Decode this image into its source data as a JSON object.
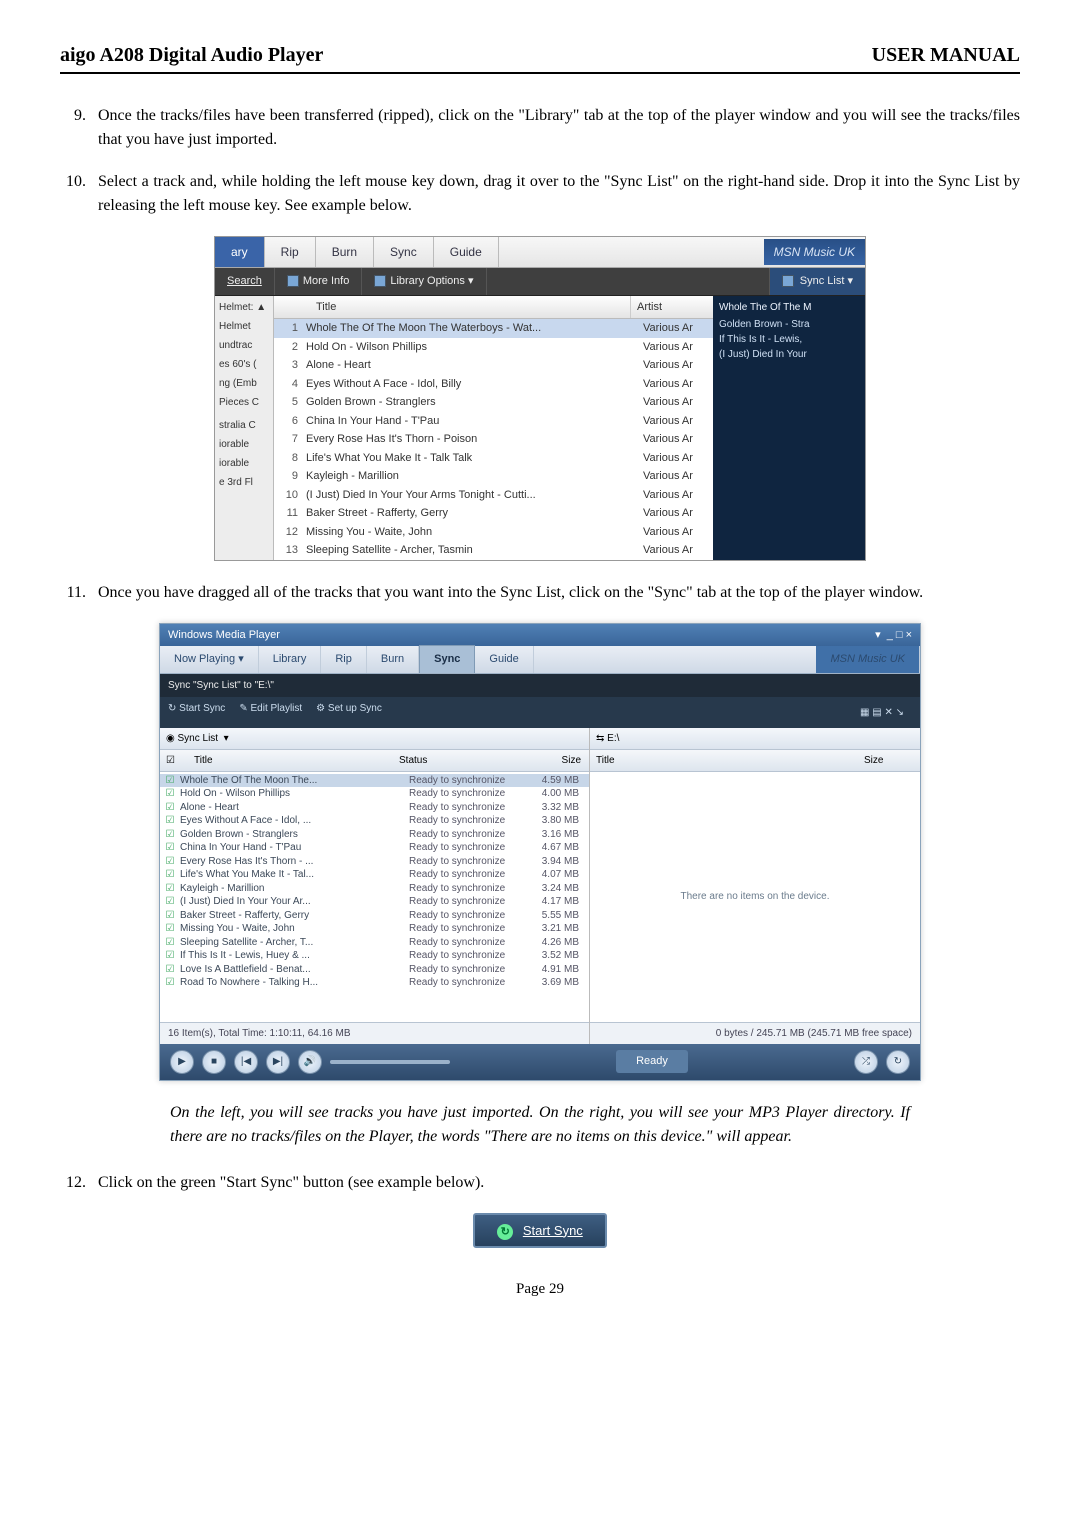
{
  "header": {
    "product": "aigo A208 Digital Audio Player",
    "doc": "USER MANUAL"
  },
  "steps": {
    "s9": "Once the tracks/files have been transferred (ripped), click on the \"Library\" tab at the top of the player window and you will see the tracks/files that you have just imported.",
    "s10": "Select a track and, while holding the left mouse key down, drag it over to the \"Sync List\" on the right-hand side.  Drop it into the Sync List by releasing the left mouse key.  See example below.",
    "s11": "Once you have dragged all of the tracks that you want into the Sync List, click on the \"Sync\" tab at the top of the player window.",
    "s12": "Click on the green \"Start Sync\" button (see example below)."
  },
  "ss1": {
    "tabs": {
      "ary": "ary",
      "rip": "Rip",
      "burn": "Burn",
      "sync": "Sync",
      "guide": "Guide"
    },
    "msn": "MSN Music UK",
    "toolbar": {
      "search": "Search",
      "more_info": "More Info",
      "lib_options": "Library Options ▾",
      "sync_list": "Sync List ▾"
    },
    "thead": {
      "title": "Title",
      "artist": "Artist"
    },
    "left_items": [
      "Helmet: ▲",
      "Helmet",
      "undtrac",
      "es 60's (",
      "ng (Emb",
      "Pieces C",
      "",
      "stralia C",
      "iorable",
      "iorable",
      "e 3rd Fl"
    ],
    "rows": [
      {
        "n": "1",
        "t": "Whole The Of The Moon The Waterboys - Wat...",
        "a": "Various Ar",
        "sel": true
      },
      {
        "n": "2",
        "t": "Hold On - Wilson Phillips",
        "a": "Various Ar"
      },
      {
        "n": "3",
        "t": "Alone - Heart",
        "a": "Various Ar"
      },
      {
        "n": "4",
        "t": "Eyes Without A Face - Idol, Billy",
        "a": "Various Ar"
      },
      {
        "n": "5",
        "t": "Golden Brown - Stranglers",
        "a": "Various Ar"
      },
      {
        "n": "6",
        "t": "China In Your Hand - T'Pau",
        "a": "Various Ar"
      },
      {
        "n": "7",
        "t": "Every Rose Has It's Thorn - Poison",
        "a": "Various Ar"
      },
      {
        "n": "8",
        "t": "Life's What You Make It - Talk Talk",
        "a": "Various Ar"
      },
      {
        "n": "9",
        "t": "Kayleigh - Marillion",
        "a": "Various Ar"
      },
      {
        "n": "10",
        "t": "(I Just) Died In Your Your Arms Tonight - Cutti...",
        "a": "Various Ar"
      },
      {
        "n": "11",
        "t": "Baker Street - Rafferty, Gerry",
        "a": "Various Ar"
      },
      {
        "n": "12",
        "t": "Missing You - Waite, John",
        "a": "Various Ar"
      },
      {
        "n": "13",
        "t": "Sleeping Satellite - Archer, Tasmin",
        "a": "Various Ar"
      }
    ],
    "right_panel": [
      "Whole The Of The M",
      "Golden Brown - Stra",
      "If This Is It - Lewis,",
      "(I Just) Died In Your"
    ]
  },
  "ss2": {
    "window_title": "Windows Media Player",
    "tabs": [
      "Now Playing ▾",
      "Library",
      "Rip",
      "Burn",
      "Sync",
      "Guide"
    ],
    "msn": "MSN Music UK",
    "sync_msg": "Sync \"Sync List\" to \"E:\\\"",
    "darkbar_items": [
      "Start Sync",
      "Edit Playlist",
      "Set up Sync"
    ],
    "left_dropdown": "Sync List",
    "left_cols": {
      "title": "Title",
      "status": "Status",
      "size": "Size"
    },
    "rows": [
      {
        "t": "Whole The Of The Moon The...",
        "s": "Ready to synchronize",
        "z": "4.59 MB",
        "sel": true
      },
      {
        "t": "Hold On - Wilson Phillips",
        "s": "Ready to synchronize",
        "z": "4.00 MB"
      },
      {
        "t": "Alone - Heart",
        "s": "Ready to synchronize",
        "z": "3.32 MB"
      },
      {
        "t": "Eyes Without A Face - Idol, ...",
        "s": "Ready to synchronize",
        "z": "3.80 MB"
      },
      {
        "t": "Golden Brown - Stranglers",
        "s": "Ready to synchronize",
        "z": "3.16 MB"
      },
      {
        "t": "China In Your Hand - T'Pau",
        "s": "Ready to synchronize",
        "z": "4.67 MB"
      },
      {
        "t": "Every Rose Has It's Thorn - ...",
        "s": "Ready to synchronize",
        "z": "3.94 MB"
      },
      {
        "t": "Life's What You Make It - Tal...",
        "s": "Ready to synchronize",
        "z": "4.07 MB"
      },
      {
        "t": "Kayleigh - Marillion",
        "s": "Ready to synchronize",
        "z": "3.24 MB"
      },
      {
        "t": "(I Just) Died In Your Your Ar...",
        "s": "Ready to synchronize",
        "z": "4.17 MB"
      },
      {
        "t": "Baker Street - Rafferty, Gerry",
        "s": "Ready to synchronize",
        "z": "5.55 MB"
      },
      {
        "t": "Missing You - Waite, John",
        "s": "Ready to synchronize",
        "z": "3.21 MB"
      },
      {
        "t": "Sleeping Satellite - Archer, T...",
        "s": "Ready to synchronize",
        "z": "4.26 MB"
      },
      {
        "t": "If This Is It - Lewis, Huey & ...",
        "s": "Ready to synchronize",
        "z": "3.52 MB"
      },
      {
        "t": "Love Is A Battlefield - Benat...",
        "s": "Ready to synchronize",
        "z": "4.91 MB"
      },
      {
        "t": "Road To Nowhere - Talking H...",
        "s": "Ready to synchronize",
        "z": "3.69 MB"
      }
    ],
    "left_status": "16 Item(s), Total Time: 1:10:11, 64.16 MB",
    "right_dropdown": "⇆ E:\\",
    "right_cols": {
      "title": "Title",
      "size": "Size"
    },
    "right_empty": "There are no items on the device.",
    "right_status": "0 bytes / 245.71 MB (245.71 MB free space)",
    "ready": "Ready"
  },
  "caption": "On the left, you will see tracks you have just imported. On the right, you will see your MP3 Player directory. If there are no tracks/files on the Player, the words \"There are no items on this device.\" will appear.",
  "start_sync_button": "Start Sync",
  "page_num": "Page 29"
}
